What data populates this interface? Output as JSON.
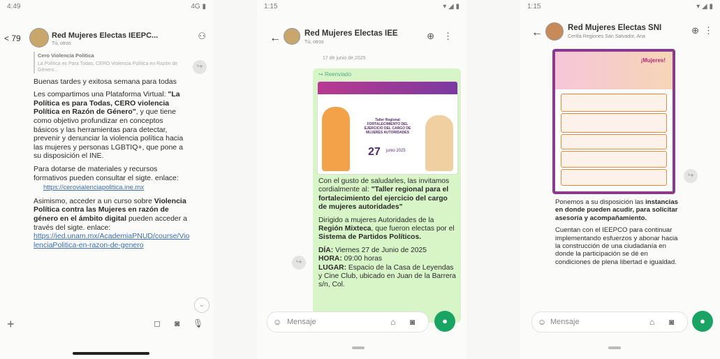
{
  "screens": [
    {
      "status": {
        "time": "4:49",
        "signal": "4G"
      },
      "header": {
        "back": "< 79",
        "title": "Red Mujeres Electas IEEPC...",
        "subtitle": "Tú, otros"
      },
      "message": {
        "quoted_title": "Cero Violencia Política",
        "quoted_text": "La Política es Para Todas, CERO Violencia Política en Razón de Género...",
        "greeting": "Buenas tardes y exitosa semana para todas",
        "p1_a": "Les compartimos una Plataforma Virtual: ",
        "p1_b": "\"La Política es para Todas, CERO violencia Política en Razón de Género\"",
        "p1_c": ", y que tiene como objetivo profundizar en conceptos básicos y las herramientas para detectar, prevenir y denunciar la violencia política hacia las mujeres y personas LGBTIQ+, que pone a su disposición el INE.",
        "p2": "Para dotarse de materiales y recursos formativos pueden consultar el sigte. enlace:",
        "link1": "https://cerovialenciapolitica.ine.mx",
        "p3_a": "Asimismo, acceder a un curso sobre ",
        "p3_b": "Violencia Política contra las Mujeres en razón de género en el ámbito digital",
        "p3_c": " pueden acceder a través del sigte. enlace:",
        "link2": "https://ied.unam.mx/AcademiaPNUD/course/ViolenciaPolitica-en-razon-de-genero"
      },
      "footer": {
        "plus": "+"
      }
    },
    {
      "status": {
        "time": "1:15"
      },
      "header": {
        "title": "Red Mujeres Electas IEE",
        "subtitle": "Tú, otros"
      },
      "date_chip": "17 de junio de 2025",
      "forwarded": "Reenviado",
      "poster": {
        "title": "Taller Regional FORTALECIMIENTO DEL EJERCICIO DEL CARGO DE MUJERES AUTORIDADES",
        "date": "27",
        "month": "junio 2025"
      },
      "message": {
        "p1_a": "Con el gusto de saludarles, las invitamos cordialmente al: ",
        "p1_b": "\"Taller regional para el fortalecimiento del ejercicio del cargo de mujeres autoridades\"",
        "p2_a": "Dirigido a mujeres Autoridades de la ",
        "p2_b": "Región Mixteca",
        "p2_c": ", que fueron electas por el ",
        "p2_d": "Sistema de Partidos Políticos.",
        "dia_l": "DÍA:",
        "dia_v": " Viernes 27 de Junio de 2025",
        "hora_l": "HORA:",
        "hora_v": " 09:00 horas",
        "lugar_l": "LUGAR:",
        "lugar_v": " Espacio de la Casa de Leyendas y Cine Club, ubicado en Juan de la Barrera s/n, Col."
      },
      "input_placeholder": "Mensaje"
    },
    {
      "status": {
        "time": "1:15"
      },
      "header": {
        "title": "Red Mujeres Electas SNI",
        "subtitle": "Cerilla Regiones San Salvador, Ana"
      },
      "poster": {
        "title": "¡Mujeres!"
      },
      "message": {
        "p1_a": "Ponemos a su disposición las ",
        "p1_b": "instancias en donde pueden acudir, para solicitar asesoría y acompañamiento.",
        "p2": "Cuentan con el IEEPCO para continuar implementando esfuerzos y abonar hacia la construcción de una ciudadanía en donde la participación se dé en condiciones de plena libertad e igualdad."
      },
      "input_placeholder": "Mensaje"
    }
  ],
  "colors": {
    "accent_green": "#1aa463",
    "bubble_green": "#d8f5c8",
    "link": "#3a6fb0",
    "poster_purple": "#8a3a8f"
  }
}
